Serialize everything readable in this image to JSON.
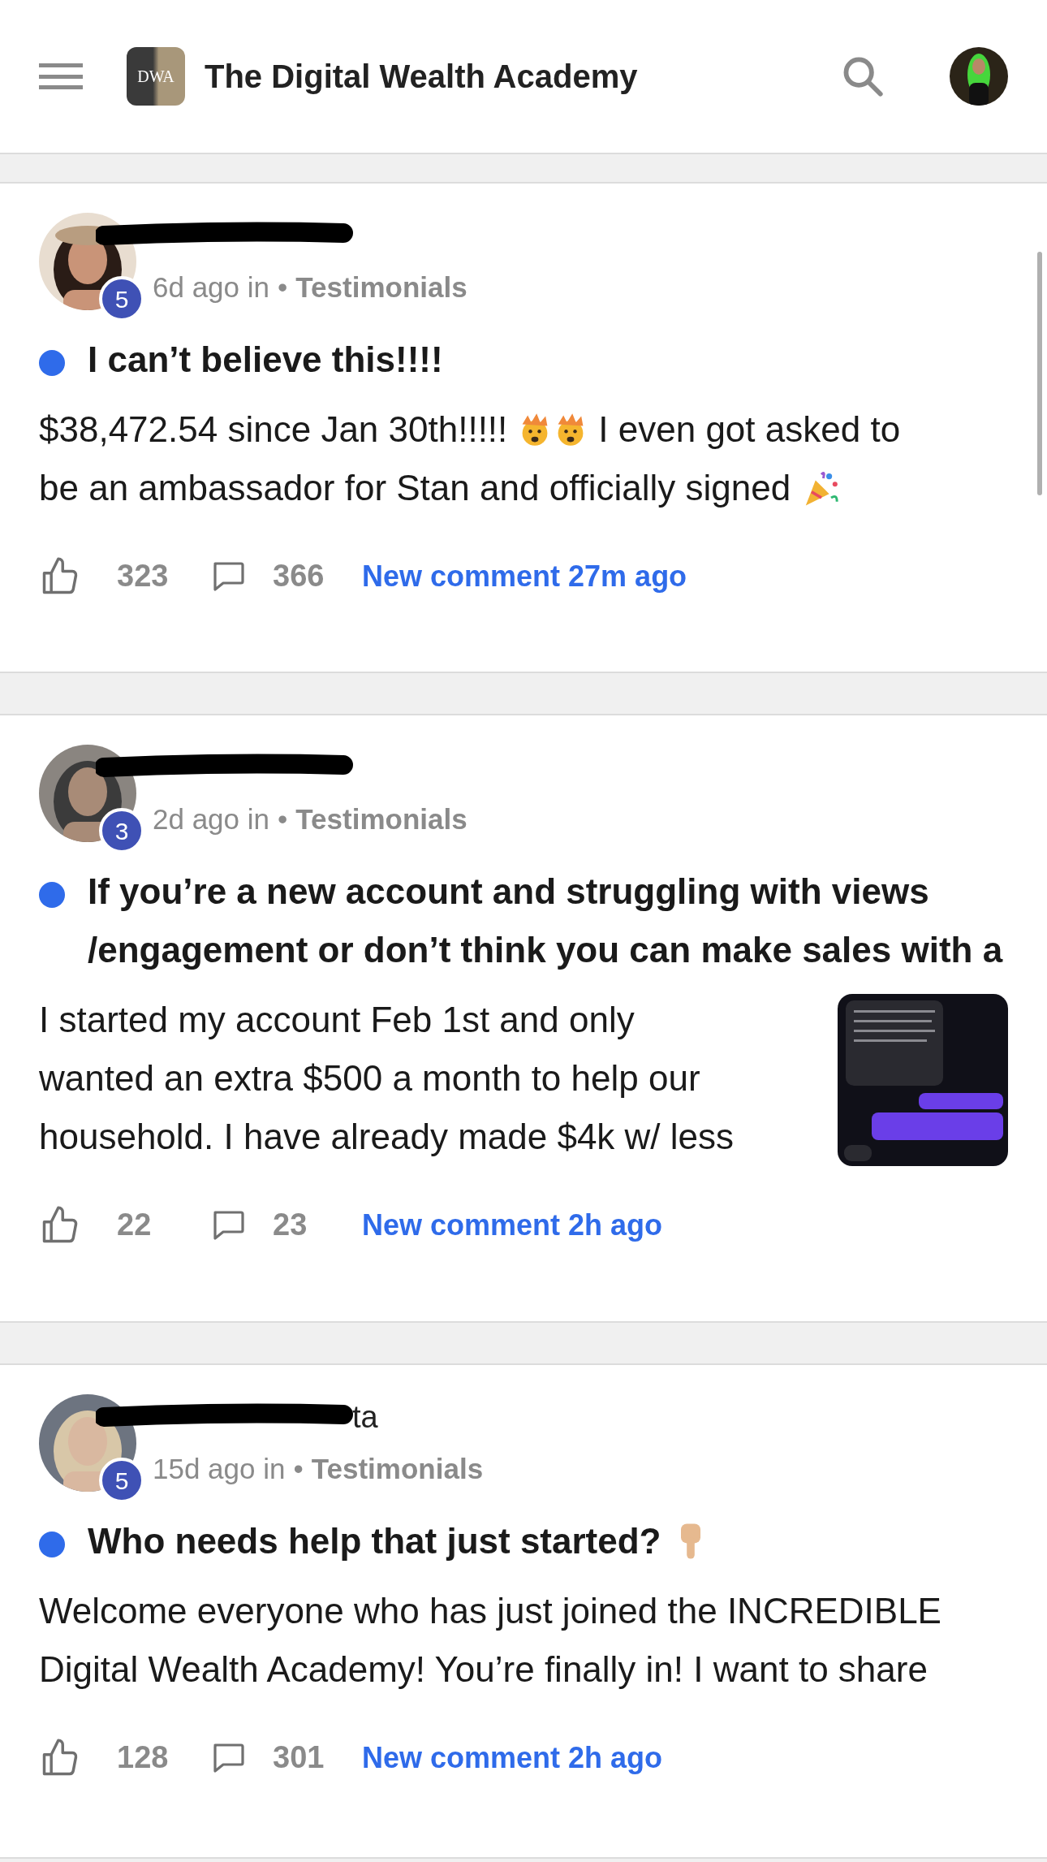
{
  "header": {
    "title": "The Digital Wealth Academy",
    "logo_text": "DWA"
  },
  "posts": [
    {
      "level_badge": "5",
      "time": "6d ago in",
      "category": "Testimonials",
      "unread": true,
      "title": "I can’t believe this!!!!",
      "separator": "•",
      "body": "$38,472.54 since Jan 30th!!!!!",
      "body_rest": "I even got asked to",
      "body_line2": "be an ambassador for Stan and officially signed",
      "likes": "323",
      "comments": "366",
      "new_comment": "New comment 27m ago"
    },
    {
      "level_badge": "3",
      "time": "2d ago in",
      "category": "Testimonials",
      "unread": true,
      "title": "If you’re a new account and struggling with views /engagement or don’t think you can make sales with a",
      "body": "I started my account Feb 1st and only wanted an extra $500 a month to help our household. I have already made $4k w/ less",
      "separator": "•",
      "likes": "22",
      "comments": "23",
      "new_comment": "New comment 2h ago"
    },
    {
      "name_visible": "ta",
      "separator": "•",
      "level_badge": "5",
      "time": "15d ago in",
      "category": "Testimonials",
      "unread": true,
      "title": "Who needs help that just started?",
      "body": "Welcome everyone who has just joined the INCREDIBLE Digital Wealth Academy! You’re finally in! I want to share",
      "likes": "128",
      "comments": "301",
      "new_comment": "New comment 2h ago"
    }
  ]
}
